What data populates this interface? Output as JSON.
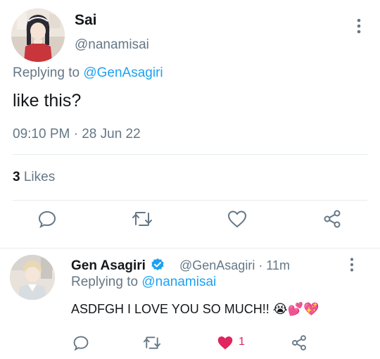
{
  "main_tweet": {
    "name": "Sai",
    "handle": "@nanamisai",
    "replying_prefix": "Replying to",
    "replying_to": "@GenAsagiri",
    "text": "like this?",
    "timestamp": "09:10 PM · 28 Jun 22",
    "likes_count": "3",
    "likes_label": "Likes",
    "actions": [
      "reply-icon",
      "retweet-icon",
      "like-icon",
      "share-icon"
    ]
  },
  "reply_tweet": {
    "name": "Gen Asagiri",
    "verified": true,
    "handle": "@GenAsagiri · 11m",
    "replying_prefix": "Replying to",
    "replying_to": "@nanamisai",
    "text": "ASDFGH I LOVE YOU SO MUCH!! 😭💕💖",
    "like_count": "1",
    "actions": [
      "reply-icon",
      "retweet-icon",
      "liked-heart-icon",
      "share-icon"
    ]
  },
  "colors": {
    "accent": "#1da1f2",
    "muted": "#657786",
    "text": "#14171a",
    "liked": "#e0245e",
    "divider": "#e6ecf0"
  }
}
